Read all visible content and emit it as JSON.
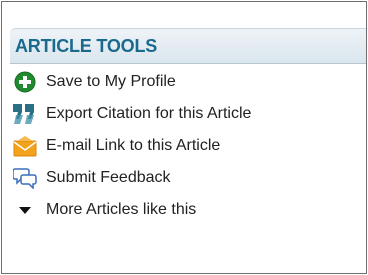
{
  "panel": {
    "title": "ARTICLE TOOLS",
    "accent_color": "#1a6a8e",
    "items": [
      {
        "label": "Save to My Profile",
        "icon": "plus-circle-icon",
        "color": "#1f8a2e"
      },
      {
        "label": "Export Citation for this Article",
        "icon": "quote-icon",
        "color": "#2b7a8f"
      },
      {
        "label": "E-mail Link to this Article",
        "icon": "envelope-icon",
        "color": "#f3a21c"
      },
      {
        "label": "Submit Feedback",
        "icon": "speech-bubbles-icon",
        "color": "#3a6fb8"
      },
      {
        "label": "More Articles like this",
        "icon": "caret-down-icon",
        "color": "#111111"
      }
    ]
  }
}
